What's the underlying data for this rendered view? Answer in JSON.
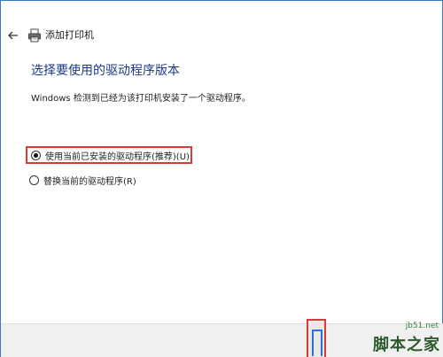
{
  "window": {
    "title": "添加打印机"
  },
  "main": {
    "heading": "选择要使用的驱动程序版本",
    "info_text": "Windows 检测到已经为该打印机安装了一个驱动程序。",
    "options": [
      {
        "label": "使用当前已安装的驱动程序(推荐)(U)",
        "selected": true
      },
      {
        "label": "替换当前的驱动程序(R)",
        "selected": false
      }
    ]
  },
  "watermark": {
    "site": "jb51.net",
    "name": "脚本之家"
  },
  "colors": {
    "accent": "#1e3a8a",
    "highlight": "#d93a3a",
    "border": "#3c78c8"
  }
}
